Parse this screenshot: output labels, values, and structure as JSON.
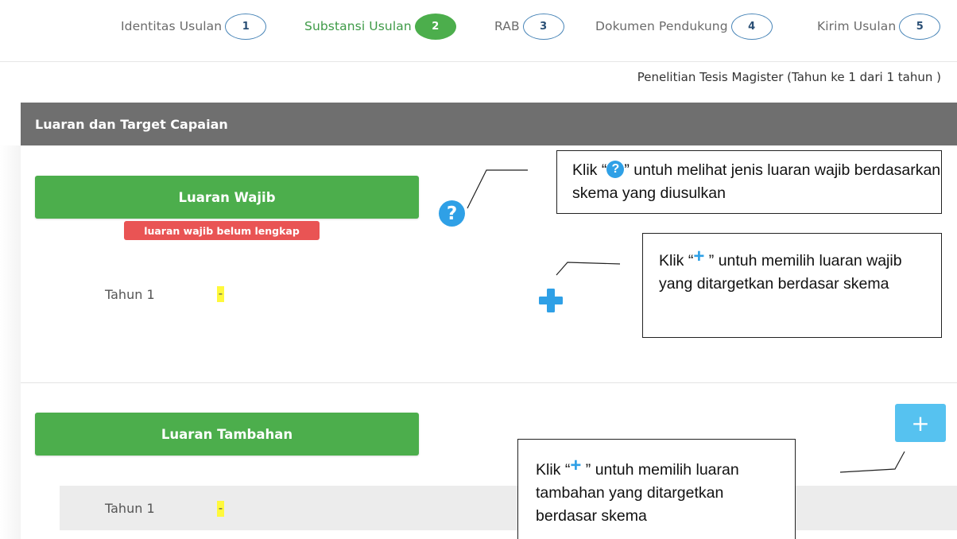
{
  "steps": [
    {
      "label": "Identitas Usulan",
      "num": "1",
      "active": false
    },
    {
      "label": "Substansi Usulan",
      "num": "2",
      "active": true
    },
    {
      "label": "RAB",
      "num": "3",
      "active": false
    },
    {
      "label": "Dokumen Pendukung",
      "num": "4",
      "active": false
    },
    {
      "label": "Kirim Usulan",
      "num": "5",
      "active": false
    }
  ],
  "scheme_info": "Penelitian Tesis Magister (Tahun ke 1 dari 1 tahun )",
  "panel": {
    "title": "Luaran dan Target Capaian",
    "wajib": {
      "button": "Luaran Wajib",
      "badge": "luaran wajib belum lengkap",
      "row_label": "Tahun 1",
      "row_value": "-"
    },
    "tambahan": {
      "button": "Luaran Tambahan",
      "add_symbol": "+",
      "row_label": "Tahun 1",
      "row_value": "-"
    }
  },
  "icons": {
    "help": "question-circle-icon",
    "help_glyph": "?",
    "add_wajib": "plus-icon"
  },
  "callouts": {
    "help": {
      "prefix": "Klik “",
      "icon_glyph": "?",
      "suffix": "” untuh melihat jenis luaran wajib berdasarkan skema yang diusulkan"
    },
    "add_wajib": {
      "prefix": "Klik “",
      "icon_glyph": "+",
      "suffix": " ” untuh memilih luaran wajib yang ditargetkan berdasar skema"
    },
    "add_tambahan": {
      "prefix": "Klik “",
      "icon_glyph": "+",
      "suffix": " ” untuh memilih luaran tambahan yang ditargetkan berdasar skema"
    }
  },
  "colors": {
    "green": "#4cae4c",
    "header_gray": "#6f6f6f",
    "badge_red": "#e95454",
    "accent_blue": "#2fa0e6",
    "highlight_yellow": "#fff93c"
  }
}
